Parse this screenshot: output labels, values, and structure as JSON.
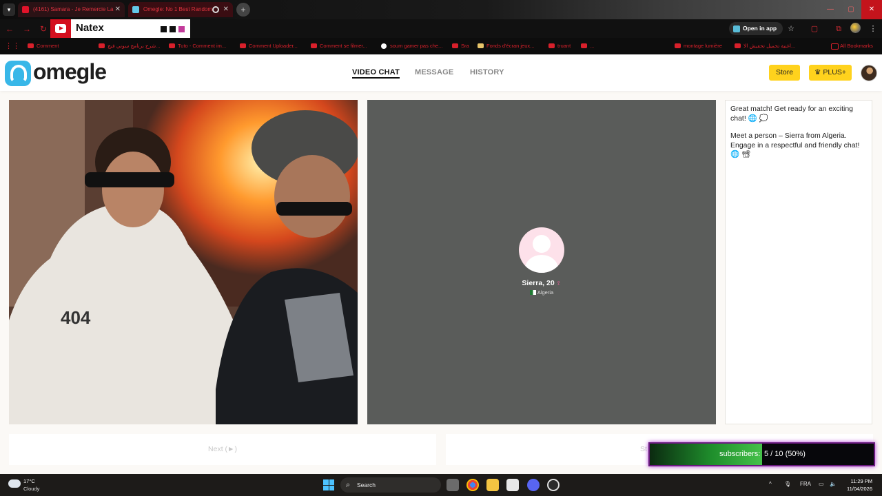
{
  "browser": {
    "tabs": [
      {
        "title": "(4161) Samara - Je Remercie La",
        "active": false
      },
      {
        "title": "Omegle: No 1 Best Random",
        "active": true
      }
    ],
    "open_in_app_label": "Open in app",
    "bookmarks": [
      "Comment",
      "شرح برنامج سوني فيج...",
      "Tuto - Comment im...",
      "Comment Uploader...",
      "Comment se filmer...",
      "soum gamer pas che...",
      "Sra",
      "Fonds d'écran jeux...",
      "truant",
      "...",
      "montage lumière",
      "اغنية تحميل تحفيش الا...",
      "All Bookmarks"
    ]
  },
  "overlay": {
    "channel_name": "Natex",
    "subscribers_label": "subscribers:",
    "subscribers_count": "5 / 10 (50%)",
    "subscribers_progress": 0.5
  },
  "site": {
    "logo_text": "omegle",
    "nav": {
      "video_chat": "VIDEO CHAT",
      "message": "MESSAGE",
      "history": "HISTORY"
    },
    "store_label": "Store",
    "plus_label": "PLUS+",
    "plus_icon": "crown-icon"
  },
  "remote": {
    "name_age": "Sierra, 20",
    "gender_symbol": "♀",
    "country": "Algeria"
  },
  "chat": {
    "messages": [
      "Great match! Get ready for an exciting chat! 🌐 💭",
      "Meet a person – Sierra from Algeria. Engage in a respectful and friendly chat! 🌐 📽"
    ]
  },
  "controls": {
    "next_label": "Next (►)",
    "stop_label": "St"
  },
  "taskbar": {
    "weather_temp": "17°C",
    "weather_desc": "Cloudy",
    "search_label": "Search",
    "language": "FRA",
    "time": "11:29 PM",
    "date": "11/04/2026"
  },
  "colors": {
    "accent_yellow": "#ffd21d",
    "logo_blue": "#38b7e8",
    "progress_green": "#45c14a"
  }
}
